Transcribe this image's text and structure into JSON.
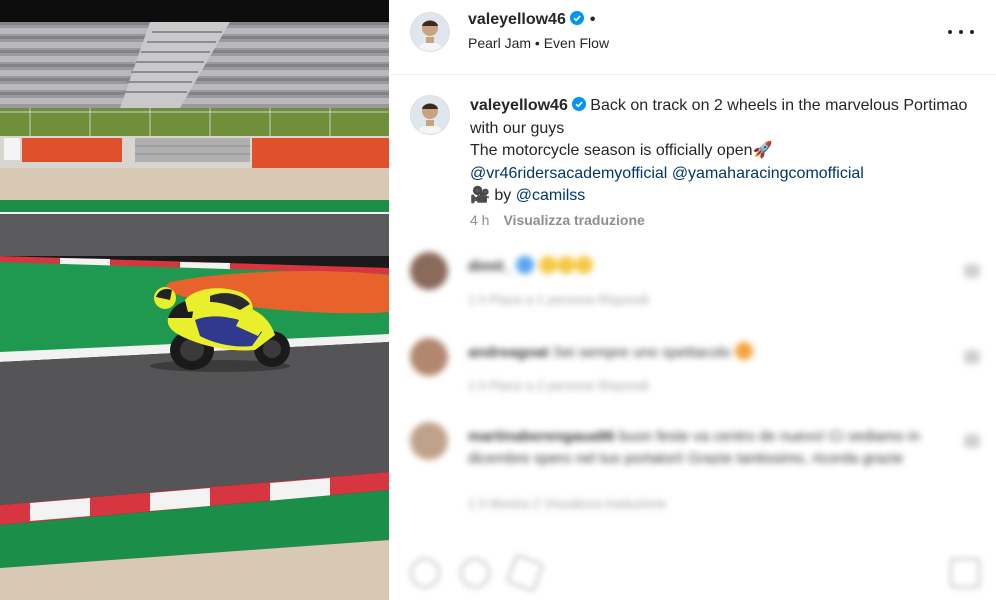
{
  "post": {
    "username": "valeyellow46",
    "music": "Pearl Jam • Even Flow",
    "header_dot": "•"
  },
  "caption": {
    "username": "valeyellow46",
    "line1": "Back on track on 2 wheels in the marvelous Portimao with our guys",
    "line2": "The motorcycle season is officially open🚀",
    "mention1": "@vr46ridersacademyofficial",
    "mention2": "@yamaharacingcomofficial",
    "credit_prefix": "🎥 by ",
    "mention3": "@camilss",
    "time": "4 h",
    "translate_label": "Visualizza traduzione"
  },
  "comments": [
    {
      "user": "dimit_",
      "text": "",
      "meta": "1 h   Piace a 1 persona   Rispondi"
    },
    {
      "user": "andreagoat",
      "text": "Sei sempre uno spettacolo",
      "meta": "1 h   Piace a 2 persone   Rispondi"
    },
    {
      "user": "martinaberengaua96",
      "text": "buon feste va centro de nuevo! Ci vediamo in dicembre spero nel tuo portatori! Grazie tantissimo, ricorda grazie",
      "meta": "1 h   Mostra 2   Visualizza traduzione"
    }
  ],
  "colors": {
    "link": "#00376b",
    "meta": "#8e8e8e",
    "verified": "#0095f6",
    "track_green": "#1b8f4a",
    "curb_red": "#d7353f",
    "runoff_orange": "#e8622b",
    "bike_yellow": "#e9ef2a"
  },
  "icons": [
    "verified-badge-icon",
    "more-options-icon",
    "heart-icon",
    "comment-icon",
    "share-icon",
    "bookmark-icon"
  ]
}
